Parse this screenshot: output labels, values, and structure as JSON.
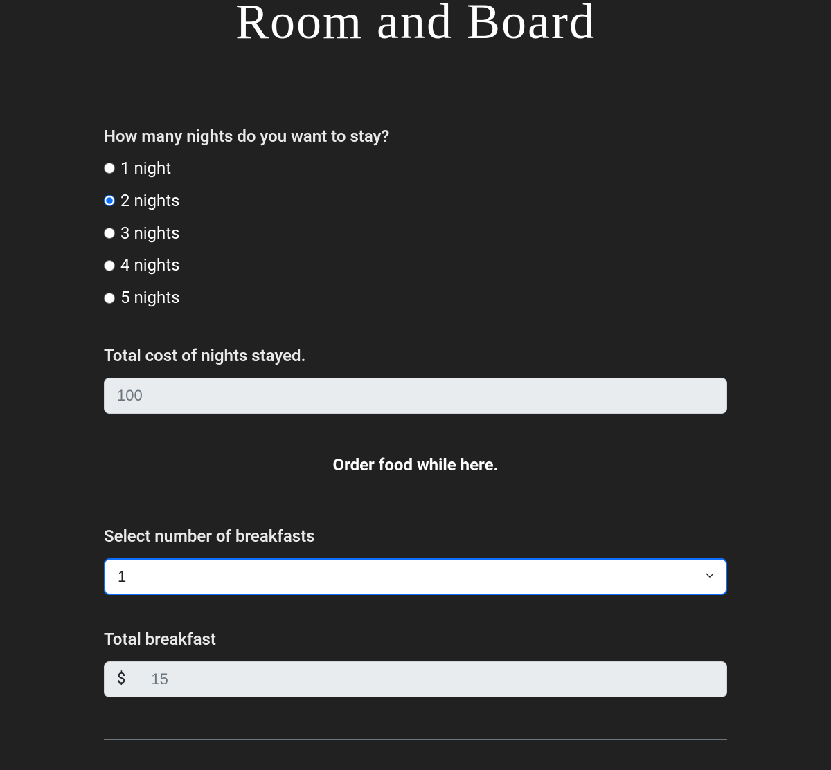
{
  "page_title": "Room and Board",
  "nights": {
    "question": "How many nights do you want to stay?",
    "options": [
      {
        "label": "1 night",
        "value": "1",
        "checked": false
      },
      {
        "label": "2 nights",
        "value": "2",
        "checked": true
      },
      {
        "label": "3 nights",
        "value": "3",
        "checked": false
      },
      {
        "label": "4 nights",
        "value": "4",
        "checked": false
      },
      {
        "label": "5 nights",
        "value": "5",
        "checked": false
      }
    ]
  },
  "total_cost": {
    "label": "Total cost of nights stayed.",
    "value": "100"
  },
  "order_food_heading": "Order food while here.",
  "breakfast_select": {
    "label": "Select number of breakfasts",
    "selected_value": "1"
  },
  "total_breakfast": {
    "label": "Total breakfast",
    "currency_symbol": "$",
    "value": "15"
  }
}
